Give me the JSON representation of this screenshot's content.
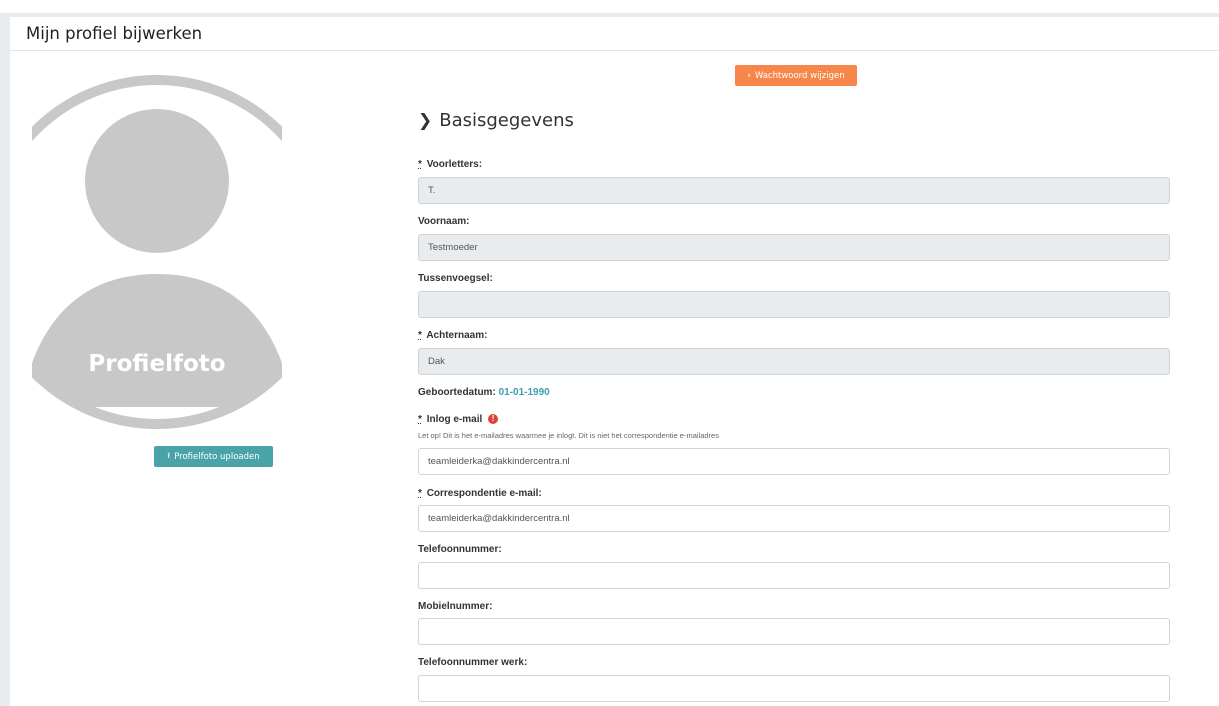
{
  "header": {
    "title": "Mijn profiel bijwerken"
  },
  "avatar": {
    "placeholder_label": "Profielfoto"
  },
  "upload_button": {
    "label": "Profielfoto uploaden",
    "icon": "upload-icon"
  },
  "password_button": {
    "label": "Wachtwoord wijzigen",
    "icon": "chevron-right-icon"
  },
  "section": {
    "title": "Basisgegevens"
  },
  "fields": {
    "voorletters": {
      "required": "*",
      "label": "Voorletters:",
      "value": "T."
    },
    "voornaam": {
      "label": "Voornaam:",
      "value": "Testmoeder"
    },
    "tussenvoegsel": {
      "label": "Tussenvoegsel:",
      "value": ""
    },
    "achternaam": {
      "required": "*",
      "label": "Achternaam:",
      "value": "Dak"
    },
    "geboortedatum": {
      "label": "Geboortedatum:",
      "value": "01-01-1990"
    },
    "inlog_email": {
      "required": "*",
      "label": "Inlog e-mail",
      "note": "Let op! Dit is het e-mailadres waarmee je inlogt. Dit is niet het correspondentie e-mailadres",
      "value": "teamleiderka@dakkindercentra.nl"
    },
    "correspondentie_email": {
      "required": "*",
      "label": "Correspondentie e-mail:",
      "value": "teamleiderka@dakkindercentra.nl"
    },
    "telefoonnummer": {
      "label": "Telefoonnummer:",
      "value": ""
    },
    "mobielnummer": {
      "label": "Mobielnummer:",
      "value": ""
    },
    "telefoonnummer_werk": {
      "label": "Telefoonnummer werk:",
      "value": ""
    }
  },
  "colors": {
    "accent_teal": "#4ba3aa",
    "accent_orange": "#f7864b",
    "warning_red": "#d9453d"
  }
}
